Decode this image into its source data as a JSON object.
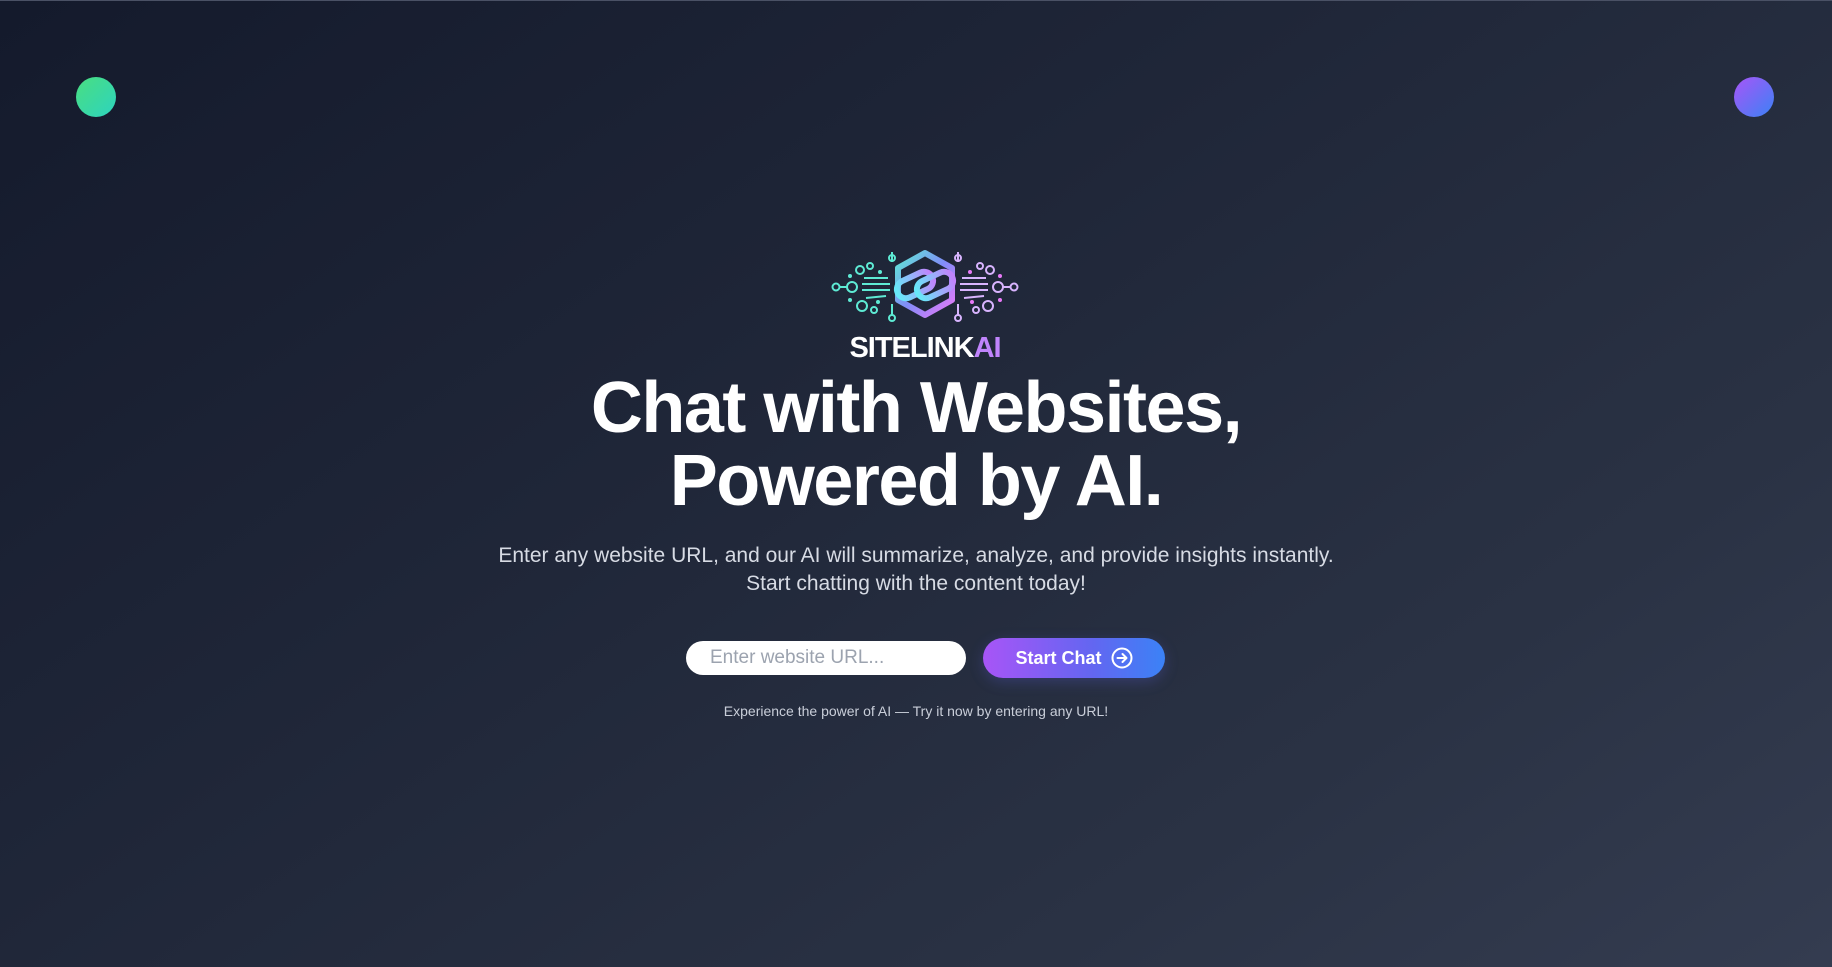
{
  "logo": {
    "text_main": "SITELINK",
    "text_accent": "AI",
    "icon": "chain-link-circuit-icon"
  },
  "hero": {
    "headline_line1": "Chat with Websites,",
    "headline_line2": "Powered by AI.",
    "subtitle": "Enter any website URL, and our AI will summarize, analyze, and provide insights instantly. Start chatting with the content today!"
  },
  "form": {
    "url_placeholder": "Enter website URL...",
    "url_value": "",
    "submit_label": "Start Chat",
    "submit_icon": "arrow-right-circle-icon"
  },
  "tagline": "Experience the power of AI — Try it now by entering any URL!",
  "colors": {
    "background_start": "#141a2c",
    "background_end": "#343c50",
    "orb_left": "#34d399",
    "orb_right": "#8b5cf6",
    "button_gradient_start": "#a855f7",
    "button_gradient_end": "#3b82f6",
    "logo_accent": "#c084fc"
  }
}
